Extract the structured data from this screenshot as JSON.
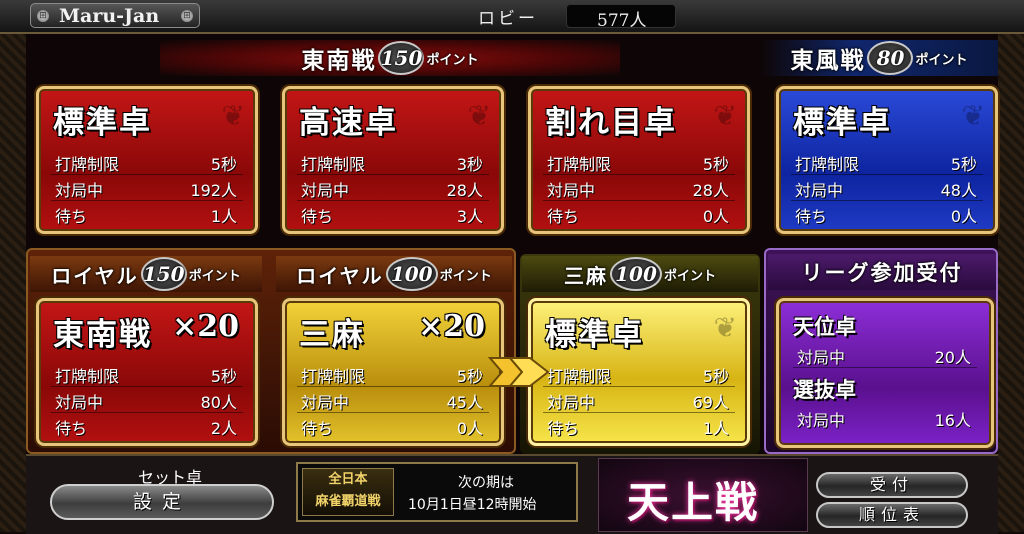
{
  "topbar": {
    "app_title": "Maru-Jan",
    "lobby_label": "ロビー",
    "lobby_count": "577人",
    "screw_glyph": "⊞"
  },
  "headers": [
    {
      "main": "東南戦",
      "points": "150",
      "unit": "ポイント"
    },
    {
      "main": "東風戦",
      "points": "80",
      "unit": "ポイント"
    },
    {
      "main": "ロイヤル",
      "points": "150",
      "unit": "ポイント"
    },
    {
      "main": "ロイヤル",
      "points": "100",
      "unit": "ポイント"
    },
    {
      "main": "三麻",
      "points": "100",
      "unit": "ポイント"
    },
    {
      "main": "リーグ参加受付"
    }
  ],
  "tables": [
    {
      "title": "標準卓",
      "rows": [
        {
          "k": "打牌制限",
          "v": "5秒"
        },
        {
          "k": "対局中",
          "v": "192人"
        },
        {
          "k": "待ち",
          "v": "1人"
        }
      ]
    },
    {
      "title": "高速卓",
      "rows": [
        {
          "k": "打牌制限",
          "v": "3秒"
        },
        {
          "k": "対局中",
          "v": "28人"
        },
        {
          "k": "待ち",
          "v": "3人"
        }
      ]
    },
    {
      "title": "割れ目卓",
      "rows": [
        {
          "k": "打牌制限",
          "v": "5秒"
        },
        {
          "k": "対局中",
          "v": "28人"
        },
        {
          "k": "待ち",
          "v": "0人"
        }
      ]
    },
    {
      "title": "標準卓",
      "rows": [
        {
          "k": "打牌制限",
          "v": "5秒"
        },
        {
          "k": "対局中",
          "v": "48人"
        },
        {
          "k": "待ち",
          "v": "0人"
        }
      ]
    },
    {
      "title": "東南戦",
      "title_x": "×20",
      "rows": [
        {
          "k": "打牌制限",
          "v": "5秒"
        },
        {
          "k": "対局中",
          "v": "80人"
        },
        {
          "k": "待ち",
          "v": "2人"
        }
      ]
    },
    {
      "title": "三麻",
      "title_x": "×20",
      "rows": [
        {
          "k": "打牌制限",
          "v": "5秒"
        },
        {
          "k": "対局中",
          "v": "45人"
        },
        {
          "k": "待ち",
          "v": "0人"
        }
      ]
    },
    {
      "title": "標準卓",
      "rows": [
        {
          "k": "打牌制限",
          "v": "5秒"
        },
        {
          "k": "対局中",
          "v": "69人"
        },
        {
          "k": "待ち",
          "v": "1人"
        }
      ]
    }
  ],
  "league": [
    {
      "title": "天位卓",
      "k": "対局中",
      "v": "20人"
    },
    {
      "title": "選抜卓",
      "k": "対局中",
      "v": "16人"
    }
  ],
  "bottom": {
    "set_label": "セット卓",
    "setting_button": "設定",
    "notice_logo_line1": "全日本",
    "notice_logo_line2": "麻雀覇道戦",
    "notice_line1": "次の期は",
    "notice_line2": "10月1日昼12時開始",
    "event_title": "天上戦",
    "accept_button": "受付",
    "ranking_button": "順位表"
  },
  "colors": {
    "red_card": "#b31010",
    "blue_card": "#1f3bc4",
    "gold_card": "#e3c22c",
    "purple_card": "#7c22c8",
    "frame_gold": "#e7c57a"
  }
}
